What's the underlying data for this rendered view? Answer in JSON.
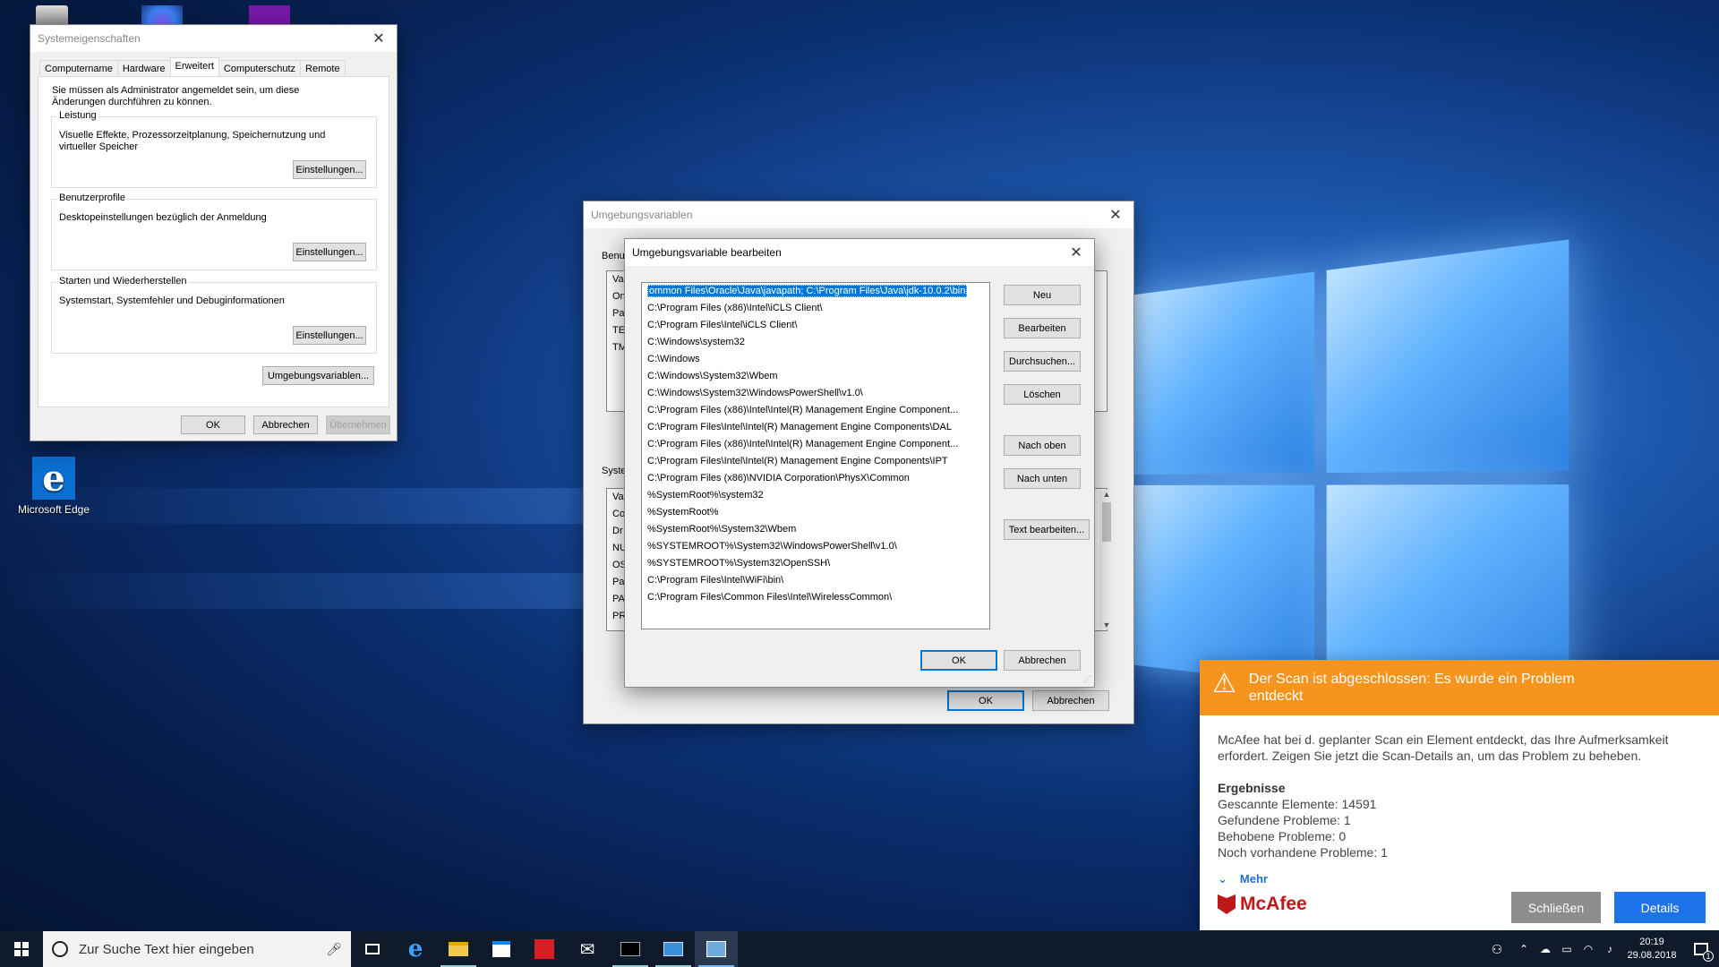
{
  "desktop": {
    "icons": [
      {
        "label": "Microsoft Edge"
      }
    ]
  },
  "sysprops": {
    "title": "Systemeigenschaften",
    "tabs": [
      "Computername",
      "Hardware",
      "Erweitert",
      "Computerschutz",
      "Remote"
    ],
    "admin_note": "Sie müssen als Administrator angemeldet sein, um diese Änderungen durchführen zu können.",
    "performance": {
      "legend": "Leistung",
      "text": "Visuelle Effekte, Prozessorzeitplanung, Speichernutzung und virtueller Speicher",
      "button": "Einstellungen..."
    },
    "profiles": {
      "legend": "Benutzerprofile",
      "text": "Desktopeinstellungen bezüglich der Anmeldung",
      "button": "Einstellungen..."
    },
    "startup": {
      "legend": "Starten und Wiederherstellen",
      "text": "Systemstart, Systemfehler und Debuginformationen",
      "button": "Einstellungen..."
    },
    "env_button": "Umgebungsvariablen...",
    "ok": "OK",
    "cancel": "Abbrechen",
    "apply": "Übernehmen"
  },
  "envvars": {
    "title": "Umgebungsvariablen",
    "user_label": "Benu",
    "user_col": "Va",
    "user_rows": [
      "On",
      "Pa",
      "TE",
      "TM"
    ],
    "system_label": "Syste",
    "system_col": "Va",
    "system_rows": [
      "Co",
      "Dr",
      "NU",
      "OS",
      "Pa",
      "PA",
      "PR"
    ],
    "ok": "OK",
    "cancel": "Abbrechen"
  },
  "editvar": {
    "title": "Umgebungsvariable bearbeiten",
    "entries": [
      "ommon Files\\Oracle\\Java\\javapath; C:\\Program Files\\Java\\jdk-10.0.2\\bin",
      "C:\\Program Files (x86)\\Intel\\iCLS Client\\",
      "C:\\Program Files\\Intel\\iCLS Client\\",
      "C:\\Windows\\system32",
      "C:\\Windows",
      "C:\\Windows\\System32\\Wbem",
      "C:\\Windows\\System32\\WindowsPowerShell\\v1.0\\",
      "C:\\Program Files (x86)\\Intel\\Intel(R) Management Engine Component...",
      "C:\\Program Files\\Intel\\Intel(R) Management Engine Components\\DAL",
      "C:\\Program Files (x86)\\Intel\\Intel(R) Management Engine Component...",
      "C:\\Program Files\\Intel\\Intel(R) Management Engine Components\\IPT",
      "C:\\Program Files (x86)\\NVIDIA Corporation\\PhysX\\Common",
      "%SystemRoot%\\system32",
      "%SystemRoot%",
      "%SystemRoot%\\System32\\Wbem",
      "%SYSTEMROOT%\\System32\\WindowsPowerShell\\v1.0\\",
      "%SYSTEMROOT%\\System32\\OpenSSH\\",
      "C:\\Program Files\\Intel\\WiFi\\bin\\",
      "C:\\Program Files\\Common Files\\Intel\\WirelessCommon\\"
    ],
    "buttons": {
      "new": "Neu",
      "edit": "Bearbeiten",
      "browse": "Durchsuchen...",
      "delete": "Löschen",
      "up": "Nach oben",
      "down": "Nach unten",
      "edit_text": "Text bearbeiten...",
      "ok": "OK",
      "cancel": "Abbrechen"
    }
  },
  "mcafee": {
    "headline": "Der Scan ist abgeschlossen: Es wurde ein Problem entdeckt",
    "message": "McAfee hat bei d. geplanter Scan ein Element entdeckt, das Ihre Aufmerksamkeit erfordert. Zeigen Sie jetzt die Scan-Details an, um das Problem zu beheben.",
    "results_heading": "Ergebnisse",
    "results": [
      "Gescannte Elemente: 14591",
      "Gefundene Probleme: 1",
      "Behobene Probleme: 0",
      "Noch vorhandene Probleme: 1"
    ],
    "more": "Mehr",
    "brand": "McAfee",
    "brand_color": "#c01818",
    "header_color": "#f7941d",
    "close_button": "Schließen",
    "details_button": "Details"
  },
  "taskbar": {
    "search_placeholder": "Zur Suche Text hier eingeben",
    "clock_time": "20:19",
    "clock_date": "29.08.2018",
    "notification_count": "1"
  }
}
